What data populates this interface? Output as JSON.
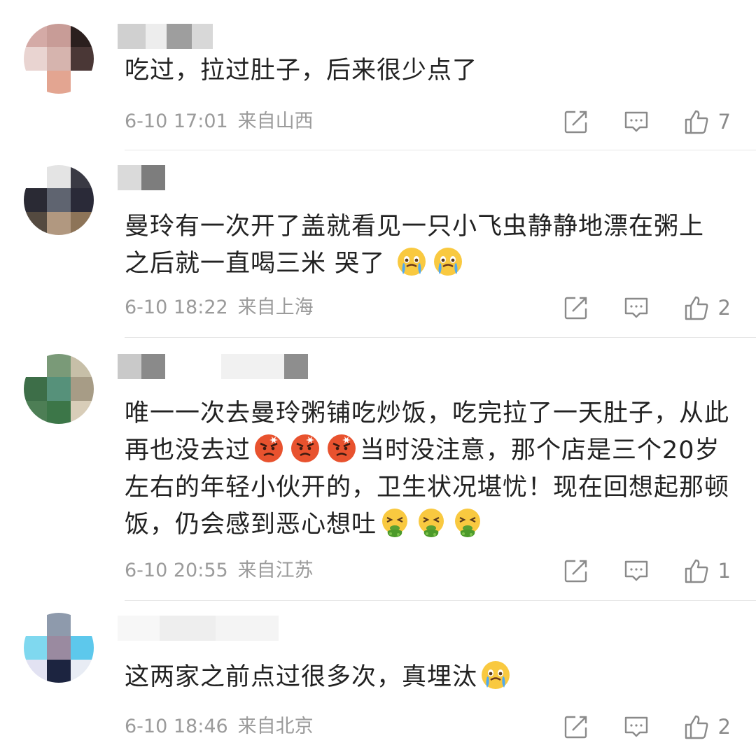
{
  "comments": [
    {
      "text_parts": [
        "吃过，拉过肚子，后来很少点了"
      ],
      "time": "6-10 17:01",
      "location": "来自山西",
      "likes": "7",
      "emoji_after": []
    },
    {
      "text_parts": [
        "曼玲有一次开了盖就看见一只小飞虫静静地漂在粥上 之后就一直喝三米 哭了"
      ],
      "time": "6-10 18:22",
      "location": "来自上海",
      "likes": "2",
      "emoji_after": [
        "crying-face",
        "crying-face"
      ]
    },
    {
      "text_parts": [
        "唯一一次去曼玲粥铺吃炒饭，吃完拉了一天肚子，从此再也没去过",
        "当时没注意，那个店是三个20岁左右的年轻小伙开的，卫生状况堪忧！现在回想起那顿饭，仍会感到恶心想吐"
      ],
      "time": "6-10 20:55",
      "location": "来自江苏",
      "likes": "1",
      "emoji_mid": [
        "angry-face",
        "angry-face",
        "angry-face"
      ],
      "emoji_after": [
        "vomiting-face",
        "vomiting-face",
        "vomiting-face"
      ]
    },
    {
      "text_parts": [
        "这两家之前点过很多次，真埋汰"
      ],
      "time": "6-10 18:46",
      "location": "来自北京",
      "likes": "2",
      "emoji_after": [
        "crying-face"
      ]
    }
  ],
  "colors": {
    "text": "#222222",
    "meta": "#9b9b9b",
    "icon": "#8a8a8a",
    "divider": "#e6e6e6"
  }
}
